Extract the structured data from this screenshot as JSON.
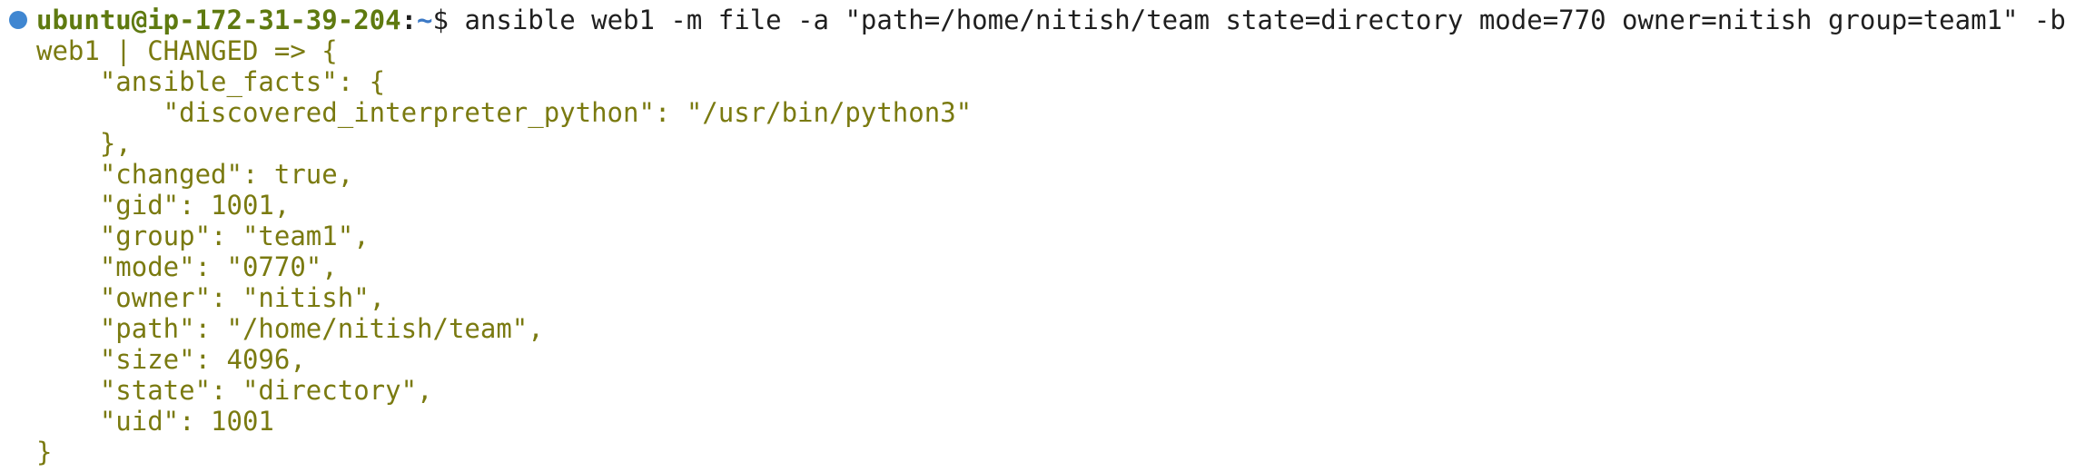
{
  "prompt": {
    "user_host": "ubuntu@ip-172-31-39-204",
    "colon": ":",
    "cwd": "~",
    "symbol": "$",
    "command": " ansible web1 -m file -a \"path=/home/nitish/team state=directory mode=770 owner=nitish group=team1\" -b"
  },
  "output": [
    "web1 | CHANGED => {",
    "    \"ansible_facts\": {",
    "        \"discovered_interpreter_python\": \"/usr/bin/python3\"",
    "    },",
    "    \"changed\": true,",
    "    \"gid\": 1001,",
    "    \"group\": \"team1\",",
    "    \"mode\": \"0770\",",
    "    \"owner\": \"nitish\",",
    "    \"path\": \"/home/nitish/team\",",
    "    \"size\": 4096,",
    "    \"state\": \"directory\",",
    "    \"uid\": 1001",
    "}"
  ],
  "colors": {
    "prompt_dot": "#3f86d1",
    "user_host": "#5f7a10",
    "cwd": "#3c79c6",
    "output_text": "#7a7a10",
    "command_text": "#1f1f1f"
  }
}
